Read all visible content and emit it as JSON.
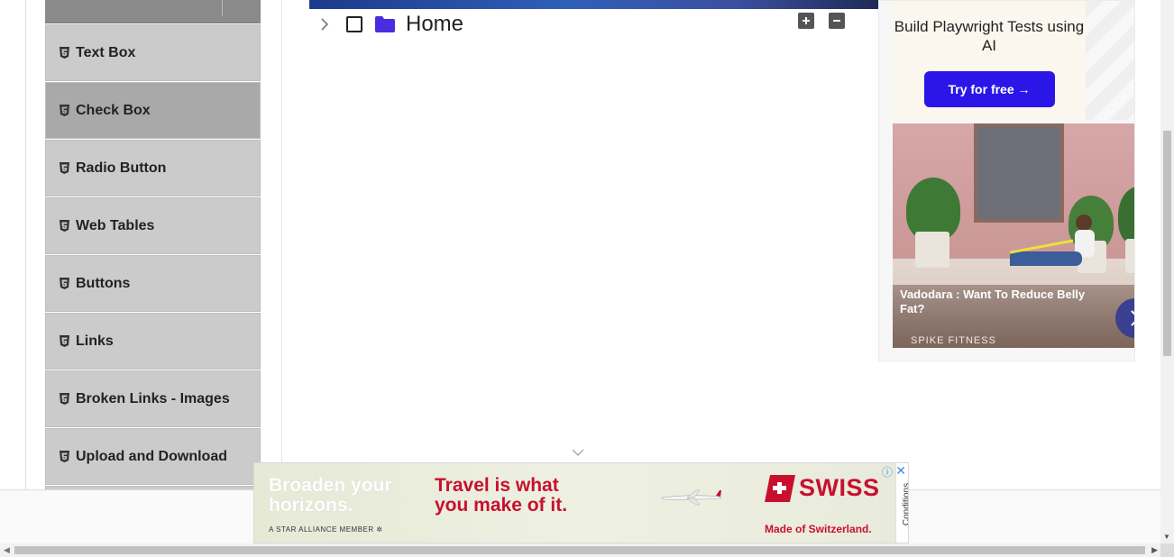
{
  "sidebar": {
    "items": [
      {
        "label": "Text Box",
        "active": false
      },
      {
        "label": "Check Box",
        "active": true
      },
      {
        "label": "Radio Button",
        "active": false
      },
      {
        "label": "Web Tables",
        "active": false
      },
      {
        "label": "Buttons",
        "active": false
      },
      {
        "label": "Links",
        "active": false
      },
      {
        "label": "Broken Links - Images",
        "active": false
      },
      {
        "label": "Upload and Download",
        "active": false
      }
    ]
  },
  "tree": {
    "root_label": "Home",
    "checked": false,
    "expanded": false,
    "folder_color": "#4a2de0"
  },
  "ad_right": {
    "playwright": {
      "title": "Build Playwright Tests using AI",
      "cta": "Try for free →",
      "cta_color": "#2b16e8"
    },
    "fitness": {
      "title": "Vadodara : Want To Reduce Belly Fat?",
      "brand": "SPIKE FITNESS"
    }
  },
  "ad_bottom": {
    "left_headline": "Broaden your horizons.",
    "star_alliance": "A STAR ALLIANCE MEMBER",
    "center_headline": "Travel is what you make of it.",
    "brand": "SWISS",
    "tagline": "Made of Switzerland.",
    "conditions": "Conditions",
    "brand_color": "#c8102e"
  }
}
